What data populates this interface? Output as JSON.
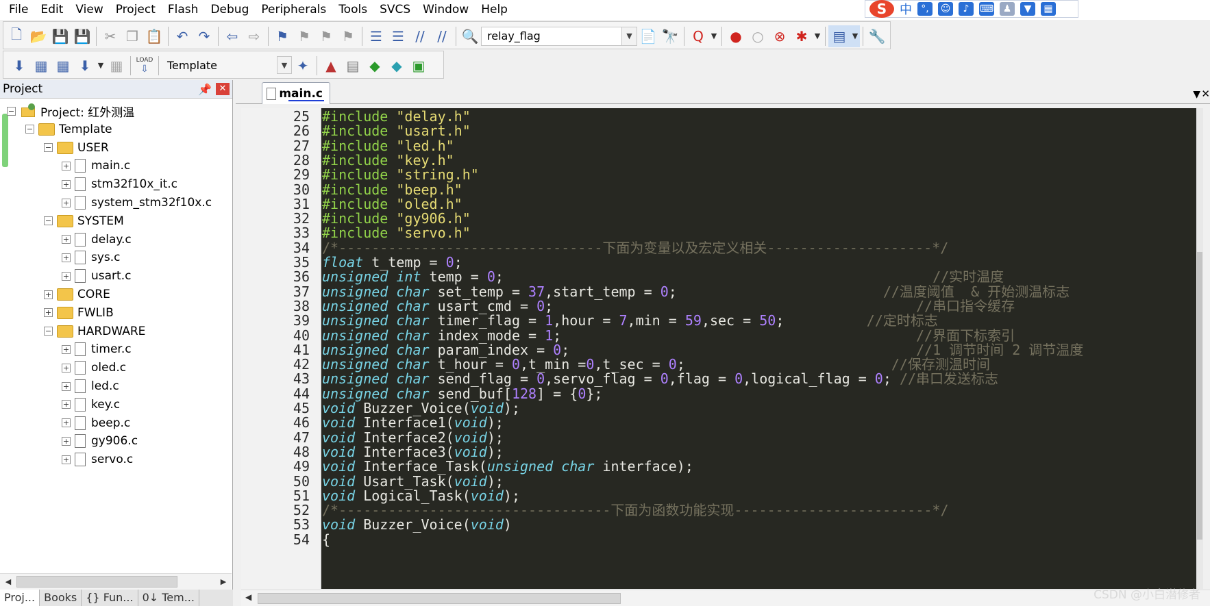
{
  "menu": [
    "File",
    "Edit",
    "View",
    "Project",
    "Flash",
    "Debug",
    "Peripherals",
    "Tools",
    "SVCS",
    "Window",
    "Help"
  ],
  "ime": {
    "logo": "S",
    "mode": "中"
  },
  "toolbar1": {
    "find_value": "relay_flag"
  },
  "toolbar2": {
    "target_value": "Template",
    "load_label": "LOAD"
  },
  "project_panel": {
    "title": "Project",
    "pin_icon": "pin-icon",
    "root": "Project: 红外测温",
    "target": "Template",
    "groups": [
      {
        "name": "USER",
        "files": [
          "main.c",
          "stm32f10x_it.c",
          "system_stm32f10x.c"
        ]
      },
      {
        "name": "SYSTEM",
        "files": [
          "delay.c",
          "sys.c",
          "usart.c"
        ]
      },
      {
        "name": "CORE",
        "files": []
      },
      {
        "name": "FWLIB",
        "files": []
      },
      {
        "name": "HARDWARE",
        "files": [
          "timer.c",
          "oled.c",
          "led.c",
          "key.c",
          "beep.c",
          "gy906.c",
          "servo.c"
        ]
      }
    ]
  },
  "bottom_tabs": [
    "Proj...",
    "Books",
    "{} Fun...",
    "0↓ Tem..."
  ],
  "editor": {
    "tab": "main.c",
    "lines": [
      {
        "n": "25",
        "segs": [
          [
            "pp",
            "#include "
          ],
          [
            "str",
            "\"delay.h\""
          ]
        ]
      },
      {
        "n": "26",
        "segs": [
          [
            "pp",
            "#include "
          ],
          [
            "str",
            "\"usart.h\""
          ]
        ]
      },
      {
        "n": "27",
        "segs": [
          [
            "pp",
            "#include "
          ],
          [
            "str",
            "\"led.h\""
          ]
        ]
      },
      {
        "n": "28",
        "segs": [
          [
            "pp",
            "#include "
          ],
          [
            "str",
            "\"key.h\""
          ]
        ]
      },
      {
        "n": "29",
        "segs": [
          [
            "pp",
            "#include "
          ],
          [
            "str",
            "\"string.h\""
          ]
        ]
      },
      {
        "n": "30",
        "segs": [
          [
            "pp",
            "#include "
          ],
          [
            "str",
            "\"beep.h\""
          ]
        ]
      },
      {
        "n": "31",
        "segs": [
          [
            "pp",
            "#include "
          ],
          [
            "str",
            "\"oled.h\""
          ]
        ]
      },
      {
        "n": "32",
        "segs": [
          [
            "pp",
            "#include "
          ],
          [
            "str",
            "\"gy906.h\""
          ]
        ]
      },
      {
        "n": "33",
        "segs": [
          [
            "pp",
            "#include "
          ],
          [
            "str",
            "\"servo.h\""
          ]
        ]
      },
      {
        "n": "34",
        "segs": [
          [
            "cm",
            "/*--------------------------------下面为变量以及宏定义相关--------------------*/"
          ]
        ]
      },
      {
        "n": "35",
        "segs": [
          [
            "kw",
            "float"
          ],
          [
            "t",
            " t_temp = "
          ],
          [
            "num",
            "0"
          ],
          [
            "t",
            ";"
          ]
        ]
      },
      {
        "n": "36",
        "segs": [
          [
            "kw",
            "unsigned int"
          ],
          [
            "t",
            " temp = "
          ],
          [
            "num",
            "0"
          ],
          [
            "t",
            ";"
          ],
          [
            "t",
            "                                                    "
          ],
          [
            "cm",
            "//实时温度"
          ]
        ]
      },
      {
        "n": "37",
        "segs": [
          [
            "kw",
            "unsigned char"
          ],
          [
            "t",
            " set_temp = "
          ],
          [
            "num",
            "37"
          ],
          [
            "t",
            ",start_temp = "
          ],
          [
            "num",
            "0"
          ],
          [
            "t",
            ";"
          ],
          [
            "t",
            "                         "
          ],
          [
            "cm",
            "//温度阈值  & 开始测温标志"
          ]
        ]
      },
      {
        "n": "38",
        "segs": [
          [
            "kw",
            "unsigned char"
          ],
          [
            "t",
            " usart_cmd = "
          ],
          [
            "num",
            "0"
          ],
          [
            "t",
            ";"
          ],
          [
            "t",
            "                                            "
          ],
          [
            "cm",
            "//串口指令缓存"
          ]
        ]
      },
      {
        "n": "39",
        "segs": [
          [
            "kw",
            "unsigned char"
          ],
          [
            "t",
            " timer_flag = "
          ],
          [
            "num",
            "1"
          ],
          [
            "t",
            ",hour = "
          ],
          [
            "num",
            "7"
          ],
          [
            "t",
            ",min = "
          ],
          [
            "num",
            "59"
          ],
          [
            "t",
            ",sec = "
          ],
          [
            "num",
            "50"
          ],
          [
            "t",
            ";"
          ],
          [
            "t",
            "          "
          ],
          [
            "cm",
            "//定时标志"
          ]
        ]
      },
      {
        "n": "40",
        "segs": [
          [
            "kw",
            "unsigned char"
          ],
          [
            "t",
            " index_mode = "
          ],
          [
            "num",
            "1"
          ],
          [
            "t",
            ";"
          ],
          [
            "t",
            "                                           "
          ],
          [
            "cm",
            "//界面下标索引"
          ]
        ]
      },
      {
        "n": "41",
        "segs": [
          [
            "kw",
            "unsigned char"
          ],
          [
            "t",
            " param_index = "
          ],
          [
            "num",
            "0"
          ],
          [
            "t",
            ";"
          ],
          [
            "t",
            "                                          "
          ],
          [
            "cm",
            "//1 调节时间 2 调节温度"
          ]
        ]
      },
      {
        "n": "42",
        "segs": [
          [
            "kw",
            "unsigned char"
          ],
          [
            "t",
            " t_hour = "
          ],
          [
            "num",
            "0"
          ],
          [
            "t",
            ",t_min ="
          ],
          [
            "num",
            "0"
          ],
          [
            "t",
            ",t_sec = "
          ],
          [
            "num",
            "0"
          ],
          [
            "t",
            ";"
          ],
          [
            "t",
            "                         "
          ],
          [
            "cm",
            "//保存测温时间"
          ]
        ]
      },
      {
        "n": "43",
        "segs": [
          [
            "kw",
            "unsigned char"
          ],
          [
            "t",
            " send_flag = "
          ],
          [
            "num",
            "0"
          ],
          [
            "t",
            ",servo_flag = "
          ],
          [
            "num",
            "0"
          ],
          [
            "t",
            ",flag = "
          ],
          [
            "num",
            "0"
          ],
          [
            "t",
            ",logical_flag = "
          ],
          [
            "num",
            "0"
          ],
          [
            "t",
            "; "
          ],
          [
            "cm",
            "//串口发送标志"
          ]
        ]
      },
      {
        "n": "44",
        "segs": [
          [
            "kw",
            "unsigned char"
          ],
          [
            "t",
            " send_buf["
          ],
          [
            "num",
            "128"
          ],
          [
            "t",
            "] = {"
          ],
          [
            "num",
            "0"
          ],
          [
            "t",
            "};"
          ]
        ]
      },
      {
        "n": "45",
        "segs": [
          [
            "kw",
            "void"
          ],
          [
            "t",
            " Buzzer_Voice("
          ],
          [
            "kw",
            "void"
          ],
          [
            "t",
            ");"
          ]
        ]
      },
      {
        "n": "46",
        "segs": [
          [
            "kw",
            "void"
          ],
          [
            "t",
            " Interface1("
          ],
          [
            "kw",
            "void"
          ],
          [
            "t",
            ");"
          ]
        ]
      },
      {
        "n": "47",
        "segs": [
          [
            "kw",
            "void"
          ],
          [
            "t",
            " Interface2("
          ],
          [
            "kw",
            "void"
          ],
          [
            "t",
            ");"
          ]
        ]
      },
      {
        "n": "48",
        "segs": [
          [
            "kw",
            "void"
          ],
          [
            "t",
            " Interface3("
          ],
          [
            "kw",
            "void"
          ],
          [
            "t",
            ");"
          ]
        ]
      },
      {
        "n": "49",
        "segs": [
          [
            "kw",
            "void"
          ],
          [
            "t",
            " Interface_Task("
          ],
          [
            "kw",
            "unsigned char"
          ],
          [
            "t",
            " interface);"
          ]
        ]
      },
      {
        "n": "50",
        "segs": [
          [
            "kw",
            "void"
          ],
          [
            "t",
            " Usart_Task("
          ],
          [
            "kw",
            "void"
          ],
          [
            "t",
            ");"
          ]
        ]
      },
      {
        "n": "51",
        "segs": [
          [
            "kw",
            "void"
          ],
          [
            "t",
            " Logical_Task("
          ],
          [
            "kw",
            "void"
          ],
          [
            "t",
            ");"
          ]
        ]
      },
      {
        "n": "52",
        "segs": [
          [
            "cm",
            "/*---------------------------------下面为函数功能实现------------------------*/"
          ]
        ]
      },
      {
        "n": "53",
        "segs": [
          [
            "kw",
            "void"
          ],
          [
            "t",
            " Buzzer_Voice("
          ],
          [
            "kw",
            "void"
          ],
          [
            "t",
            ")"
          ]
        ]
      },
      {
        "n": "54",
        "segs": [
          [
            "t",
            "{"
          ]
        ]
      }
    ]
  },
  "watermark": "CSDN @小白潜修者"
}
